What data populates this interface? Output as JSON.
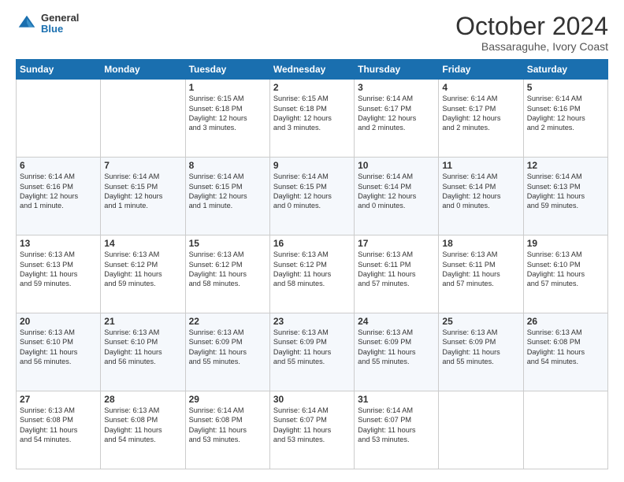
{
  "header": {
    "logo_general": "General",
    "logo_blue": "Blue",
    "month_title": "October 2024",
    "location": "Bassaraguhe, Ivory Coast"
  },
  "days_of_week": [
    "Sunday",
    "Monday",
    "Tuesday",
    "Wednesday",
    "Thursday",
    "Friday",
    "Saturday"
  ],
  "weeks": [
    [
      {
        "day": "",
        "text": ""
      },
      {
        "day": "",
        "text": ""
      },
      {
        "day": "1",
        "text": "Sunrise: 6:15 AM\nSunset: 6:18 PM\nDaylight: 12 hours\nand 3 minutes."
      },
      {
        "day": "2",
        "text": "Sunrise: 6:15 AM\nSunset: 6:18 PM\nDaylight: 12 hours\nand 3 minutes."
      },
      {
        "day": "3",
        "text": "Sunrise: 6:14 AM\nSunset: 6:17 PM\nDaylight: 12 hours\nand 2 minutes."
      },
      {
        "day": "4",
        "text": "Sunrise: 6:14 AM\nSunset: 6:17 PM\nDaylight: 12 hours\nand 2 minutes."
      },
      {
        "day": "5",
        "text": "Sunrise: 6:14 AM\nSunset: 6:16 PM\nDaylight: 12 hours\nand 2 minutes."
      }
    ],
    [
      {
        "day": "6",
        "text": "Sunrise: 6:14 AM\nSunset: 6:16 PM\nDaylight: 12 hours\nand 1 minute."
      },
      {
        "day": "7",
        "text": "Sunrise: 6:14 AM\nSunset: 6:15 PM\nDaylight: 12 hours\nand 1 minute."
      },
      {
        "day": "8",
        "text": "Sunrise: 6:14 AM\nSunset: 6:15 PM\nDaylight: 12 hours\nand 1 minute."
      },
      {
        "day": "9",
        "text": "Sunrise: 6:14 AM\nSunset: 6:15 PM\nDaylight: 12 hours\nand 0 minutes."
      },
      {
        "day": "10",
        "text": "Sunrise: 6:14 AM\nSunset: 6:14 PM\nDaylight: 12 hours\nand 0 minutes."
      },
      {
        "day": "11",
        "text": "Sunrise: 6:14 AM\nSunset: 6:14 PM\nDaylight: 12 hours\nand 0 minutes."
      },
      {
        "day": "12",
        "text": "Sunrise: 6:14 AM\nSunset: 6:13 PM\nDaylight: 11 hours\nand 59 minutes."
      }
    ],
    [
      {
        "day": "13",
        "text": "Sunrise: 6:13 AM\nSunset: 6:13 PM\nDaylight: 11 hours\nand 59 minutes."
      },
      {
        "day": "14",
        "text": "Sunrise: 6:13 AM\nSunset: 6:12 PM\nDaylight: 11 hours\nand 59 minutes."
      },
      {
        "day": "15",
        "text": "Sunrise: 6:13 AM\nSunset: 6:12 PM\nDaylight: 11 hours\nand 58 minutes."
      },
      {
        "day": "16",
        "text": "Sunrise: 6:13 AM\nSunset: 6:12 PM\nDaylight: 11 hours\nand 58 minutes."
      },
      {
        "day": "17",
        "text": "Sunrise: 6:13 AM\nSunset: 6:11 PM\nDaylight: 11 hours\nand 57 minutes."
      },
      {
        "day": "18",
        "text": "Sunrise: 6:13 AM\nSunset: 6:11 PM\nDaylight: 11 hours\nand 57 minutes."
      },
      {
        "day": "19",
        "text": "Sunrise: 6:13 AM\nSunset: 6:10 PM\nDaylight: 11 hours\nand 57 minutes."
      }
    ],
    [
      {
        "day": "20",
        "text": "Sunrise: 6:13 AM\nSunset: 6:10 PM\nDaylight: 11 hours\nand 56 minutes."
      },
      {
        "day": "21",
        "text": "Sunrise: 6:13 AM\nSunset: 6:10 PM\nDaylight: 11 hours\nand 56 minutes."
      },
      {
        "day": "22",
        "text": "Sunrise: 6:13 AM\nSunset: 6:09 PM\nDaylight: 11 hours\nand 55 minutes."
      },
      {
        "day": "23",
        "text": "Sunrise: 6:13 AM\nSunset: 6:09 PM\nDaylight: 11 hours\nand 55 minutes."
      },
      {
        "day": "24",
        "text": "Sunrise: 6:13 AM\nSunset: 6:09 PM\nDaylight: 11 hours\nand 55 minutes."
      },
      {
        "day": "25",
        "text": "Sunrise: 6:13 AM\nSunset: 6:09 PM\nDaylight: 11 hours\nand 55 minutes."
      },
      {
        "day": "26",
        "text": "Sunrise: 6:13 AM\nSunset: 6:08 PM\nDaylight: 11 hours\nand 54 minutes."
      }
    ],
    [
      {
        "day": "27",
        "text": "Sunrise: 6:13 AM\nSunset: 6:08 PM\nDaylight: 11 hours\nand 54 minutes."
      },
      {
        "day": "28",
        "text": "Sunrise: 6:13 AM\nSunset: 6:08 PM\nDaylight: 11 hours\nand 54 minutes."
      },
      {
        "day": "29",
        "text": "Sunrise: 6:14 AM\nSunset: 6:08 PM\nDaylight: 11 hours\nand 53 minutes."
      },
      {
        "day": "30",
        "text": "Sunrise: 6:14 AM\nSunset: 6:07 PM\nDaylight: 11 hours\nand 53 minutes."
      },
      {
        "day": "31",
        "text": "Sunrise: 6:14 AM\nSunset: 6:07 PM\nDaylight: 11 hours\nand 53 minutes."
      },
      {
        "day": "",
        "text": ""
      },
      {
        "day": "",
        "text": ""
      }
    ]
  ]
}
